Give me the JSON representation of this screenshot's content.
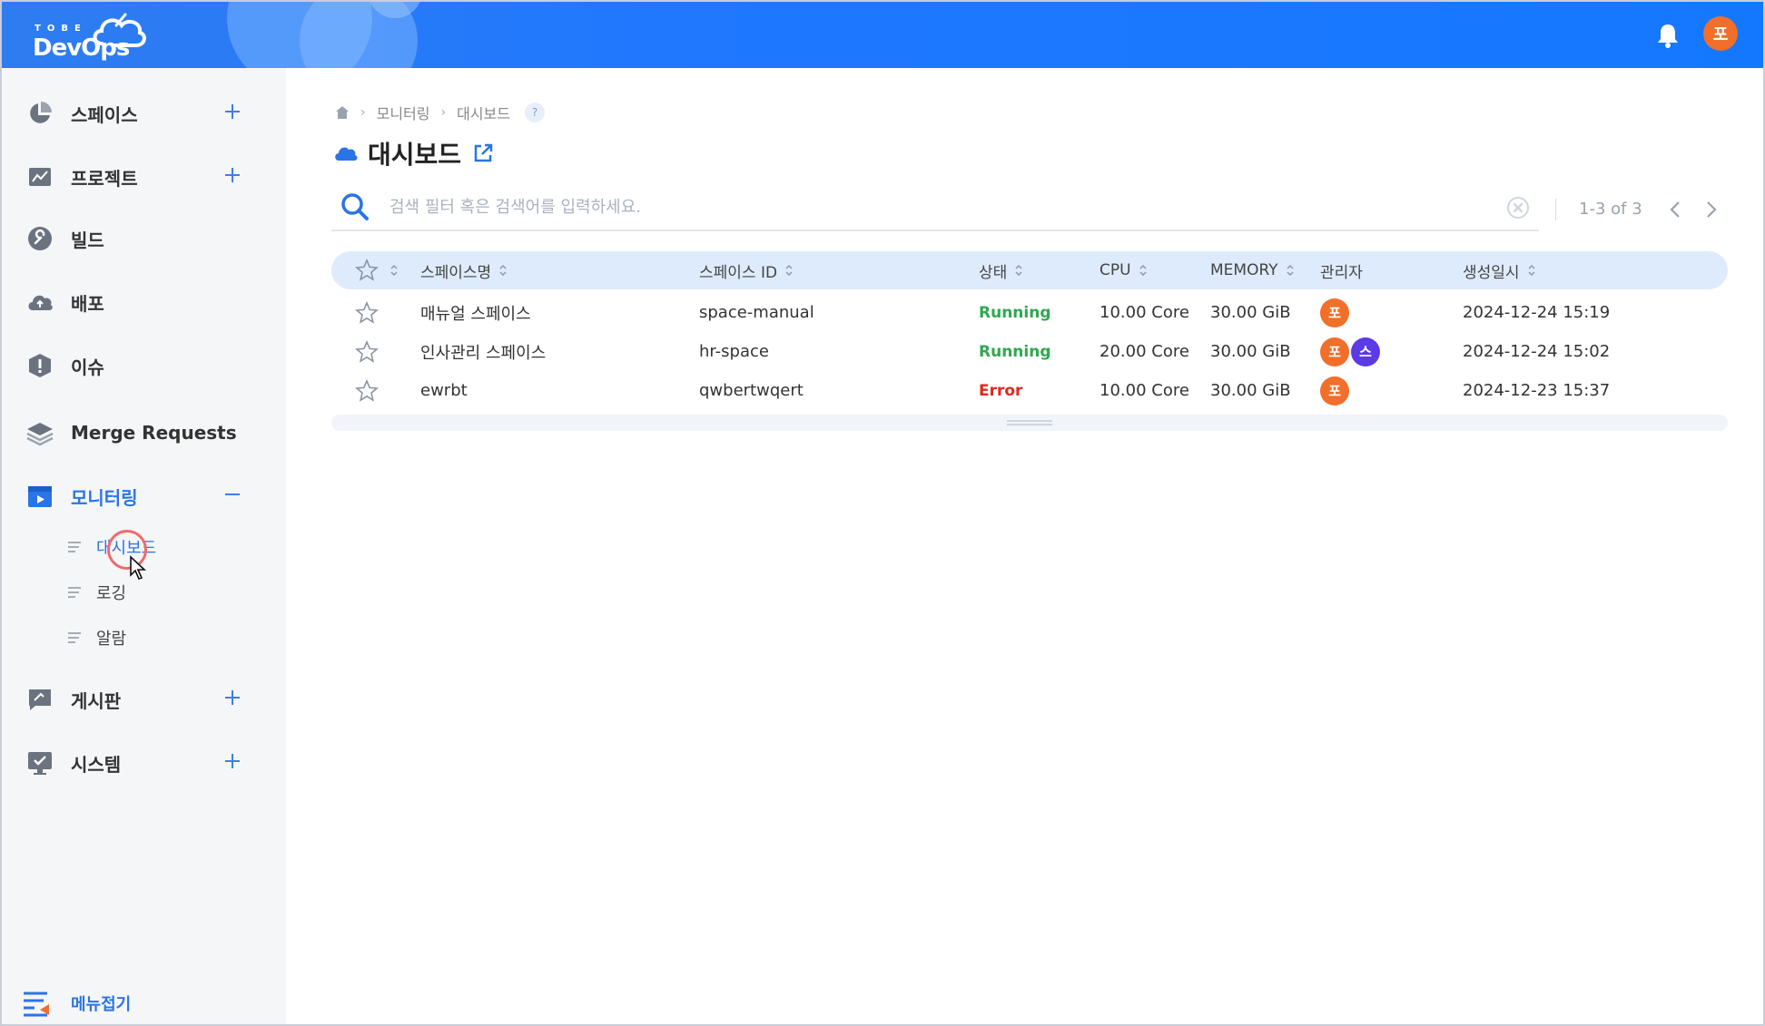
{
  "header": {
    "logo_small": "TOBE",
    "logo_main": "DevOps",
    "user_initial": "포"
  },
  "sidebar": {
    "items": [
      {
        "label": "스페이스",
        "icon": "pie-chart-icon",
        "has_plus": true
      },
      {
        "label": "프로젝트",
        "icon": "project-chart-icon",
        "has_plus": true
      },
      {
        "label": "빌드",
        "icon": "wrench-icon",
        "has_plus": false
      },
      {
        "label": "배포",
        "icon": "cloud-upload-icon",
        "has_plus": false
      },
      {
        "label": "이슈",
        "icon": "alert-icon",
        "has_plus": false
      },
      {
        "label": "Merge Requests",
        "icon": "layers-icon",
        "has_plus": false
      },
      {
        "label": "모니터링",
        "icon": "monitor-play-icon",
        "expanded": true
      },
      {
        "label": "게시판",
        "icon": "board-icon",
        "has_plus": true
      },
      {
        "label": "시스템",
        "icon": "system-monitor-icon",
        "has_plus": true
      }
    ],
    "sub_items": [
      {
        "label": "대시보드",
        "active": true
      },
      {
        "label": "로깅",
        "active": false
      },
      {
        "label": "알람",
        "active": false
      }
    ],
    "collapse_label": "메뉴접기"
  },
  "breadcrumb": {
    "items": [
      "모니터링",
      "대시보드"
    ],
    "help": "?"
  },
  "page": {
    "title": "대시보드"
  },
  "search": {
    "placeholder": "검색 필터 혹은 검색어를 입력하세요.",
    "value": ""
  },
  "pager": {
    "text": "1-3 of 3"
  },
  "table": {
    "headers": [
      "스페이스명",
      "스페이스 ID",
      "상태",
      "CPU",
      "MEMORY",
      "관리자",
      "생성일시"
    ],
    "rows": [
      {
        "name": "매뉴얼 스페이스",
        "id": "space-manual",
        "status": "Running",
        "cpu": "10.00 Core",
        "memory": "30.00 GiB",
        "managers": [
          "포"
        ],
        "created": "2024-12-24 15:19"
      },
      {
        "name": "인사관리 스페이스",
        "id": "hr-space",
        "status": "Running",
        "cpu": "20.00 Core",
        "memory": "30.00 GiB",
        "managers": [
          "포",
          "스"
        ],
        "created": "2024-12-24 15:02"
      },
      {
        "name": "ewrbt",
        "id": "qwbertwqert",
        "status": "Error",
        "cpu": "10.00 Core",
        "memory": "30.00 GiB",
        "managers": [
          "포"
        ],
        "created": "2024-12-23 15:37"
      }
    ]
  },
  "colors": {
    "brand": "#1f78ff",
    "accent": "#2a74e6",
    "running": "#2fa84f",
    "error": "#e0281e",
    "avatar_orange": "#f26e2b",
    "avatar_purple": "#5b3ae8"
  }
}
